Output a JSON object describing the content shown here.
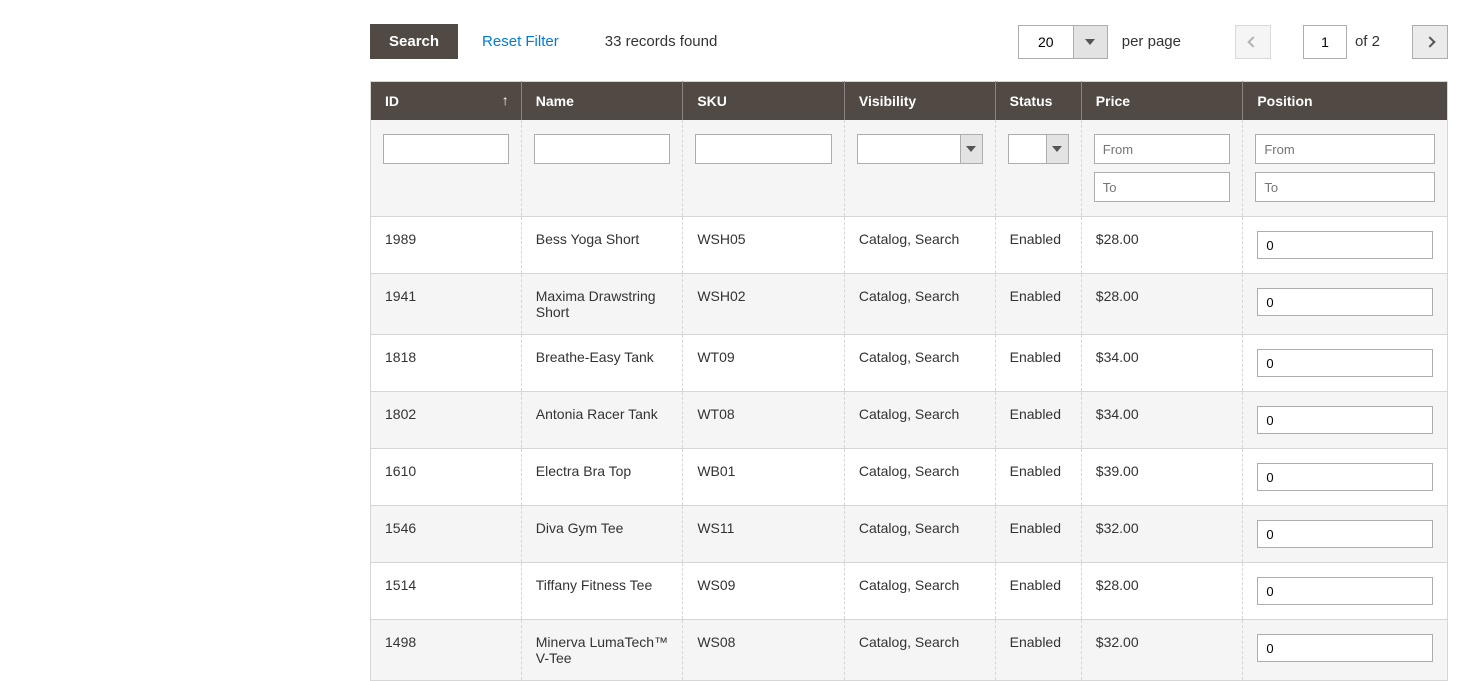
{
  "toolbar": {
    "search_label": "Search",
    "reset_label": "Reset Filter",
    "records_found": "33 records found",
    "page_size": "20",
    "per_page_label": "per page",
    "current_page": "1",
    "of_label": "of 2"
  },
  "columns": {
    "id": "ID",
    "name": "Name",
    "sku": "SKU",
    "visibility": "Visibility",
    "status": "Status",
    "price": "Price",
    "position": "Position"
  },
  "filters": {
    "from_placeholder": "From",
    "to_placeholder": "To"
  },
  "rows": [
    {
      "id": "1989",
      "name": "Bess Yoga Short",
      "sku": "WSH05",
      "visibility": "Catalog, Search",
      "status": "Enabled",
      "price": "$28.00",
      "position": "0"
    },
    {
      "id": "1941",
      "name": "Maxima Drawstring Short",
      "sku": "WSH02",
      "visibility": "Catalog, Search",
      "status": "Enabled",
      "price": "$28.00",
      "position": "0"
    },
    {
      "id": "1818",
      "name": "Breathe-Easy Tank",
      "sku": "WT09",
      "visibility": "Catalog, Search",
      "status": "Enabled",
      "price": "$34.00",
      "position": "0"
    },
    {
      "id": "1802",
      "name": "Antonia Racer Tank",
      "sku": "WT08",
      "visibility": "Catalog, Search",
      "status": "Enabled",
      "price": "$34.00",
      "position": "0"
    },
    {
      "id": "1610",
      "name": "Electra Bra Top",
      "sku": "WB01",
      "visibility": "Catalog, Search",
      "status": "Enabled",
      "price": "$39.00",
      "position": "0"
    },
    {
      "id": "1546",
      "name": "Diva Gym Tee",
      "sku": "WS11",
      "visibility": "Catalog, Search",
      "status": "Enabled",
      "price": "$32.00",
      "position": "0"
    },
    {
      "id": "1514",
      "name": "Tiffany Fitness Tee",
      "sku": "WS09",
      "visibility": "Catalog, Search",
      "status": "Enabled",
      "price": "$28.00",
      "position": "0"
    },
    {
      "id": "1498",
      "name": "Minerva LumaTech™ V-Tee",
      "sku": "WS08",
      "visibility": "Catalog, Search",
      "status": "Enabled",
      "price": "$32.00",
      "position": "0"
    }
  ]
}
